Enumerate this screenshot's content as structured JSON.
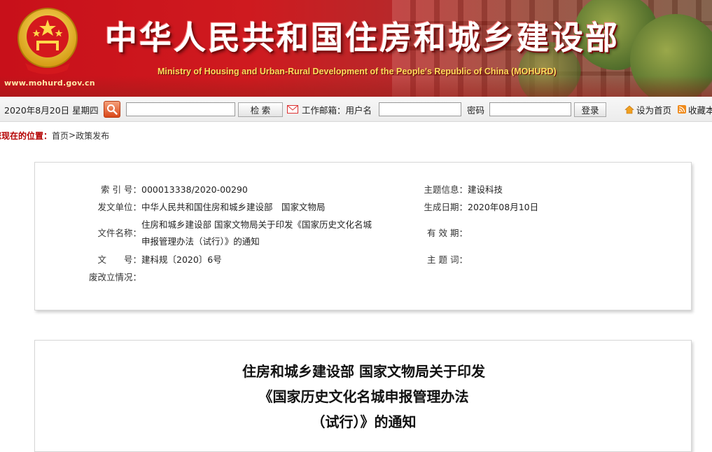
{
  "banner": {
    "title": "中华人民共和国住房和城乡建设部",
    "subtitle": "Ministry of Housing and Urban-Rural Development of the People's Republic of China (MOHURD)",
    "url": "www.mohurd.gov.cn",
    "emblem_icon": "national-emblem-icon",
    "colors": {
      "banner_red": "#c8101a",
      "title_white": "#ffffff",
      "subtitle_gold": "#ffde5c"
    }
  },
  "toolbar": {
    "date": "2020年8月20日 星期四",
    "search_icon": "search-icon",
    "search_button": "检  索",
    "mail_icon": "mail-icon",
    "mail_label": "工作邮箱：用户名",
    "password_label": "密码",
    "login_button": "登录",
    "home_icon": "home-icon",
    "set_home": "设为首页",
    "rss_icon": "rss-icon",
    "favorite": "收藏本"
  },
  "breadcrumb": {
    "label": "您现在的位置：",
    "items": [
      "首页",
      ">",
      "政策发布"
    ]
  },
  "info": {
    "index_label": "索 引 号：",
    "index_value": "000013338/2020-00290",
    "topic_label": "主题信息：",
    "topic_value": "建设科技",
    "issuer_label": "发文单位：",
    "issuer_value": "中华人民共和国住房和城乡建设部　国家文物局",
    "date_label": "生成日期：",
    "date_value": "2020年08月10日",
    "filename_label": "文件名称：",
    "filename_value": "住房和城乡建设部 国家文物局关于印发《国家历史文化名城申报管理办法（试行）》的通知",
    "validity_label": "有 效 期：",
    "validity_value": "",
    "docno_label": "文　　号：",
    "docno_value": "建科规〔2020〕6号",
    "keywords_label": "主 题 词：",
    "keywords_value": "",
    "status_label": "废改立情况：",
    "status_value": ""
  },
  "document": {
    "title_line1": "住房和城乡建设部 国家文物局关于印发",
    "title_line2": "《国家历史文化名城申报管理办法",
    "title_line3": "（试行）》的通知"
  }
}
